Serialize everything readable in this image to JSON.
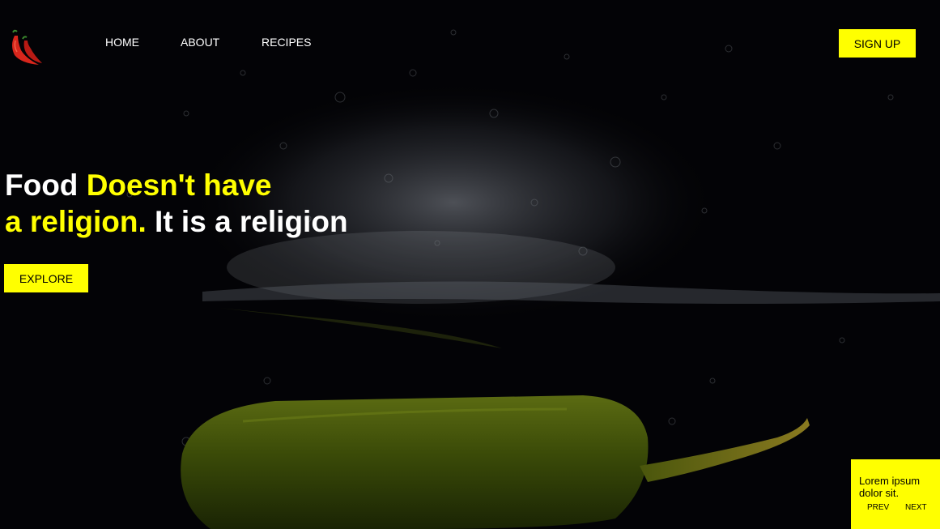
{
  "nav": {
    "logo_icon": "chili-pepper-icon",
    "links": [
      "HOME",
      "ABOUT",
      "RECIPES"
    ],
    "signup_label": "SIGN UP"
  },
  "hero": {
    "line1_white": "Food ",
    "line1_yellow": "Doesn't have",
    "line2_yellow": "a religion.",
    "line2_white": " It is a religion",
    "explore_label": "EXPLORE"
  },
  "card": {
    "text": "Lorem ipsum dolor sit.",
    "prev_label": "PREV",
    "next_label": "NEXT"
  },
  "colors": {
    "accent": "#ffff00",
    "background": "#030306",
    "text": "#ffffff"
  }
}
